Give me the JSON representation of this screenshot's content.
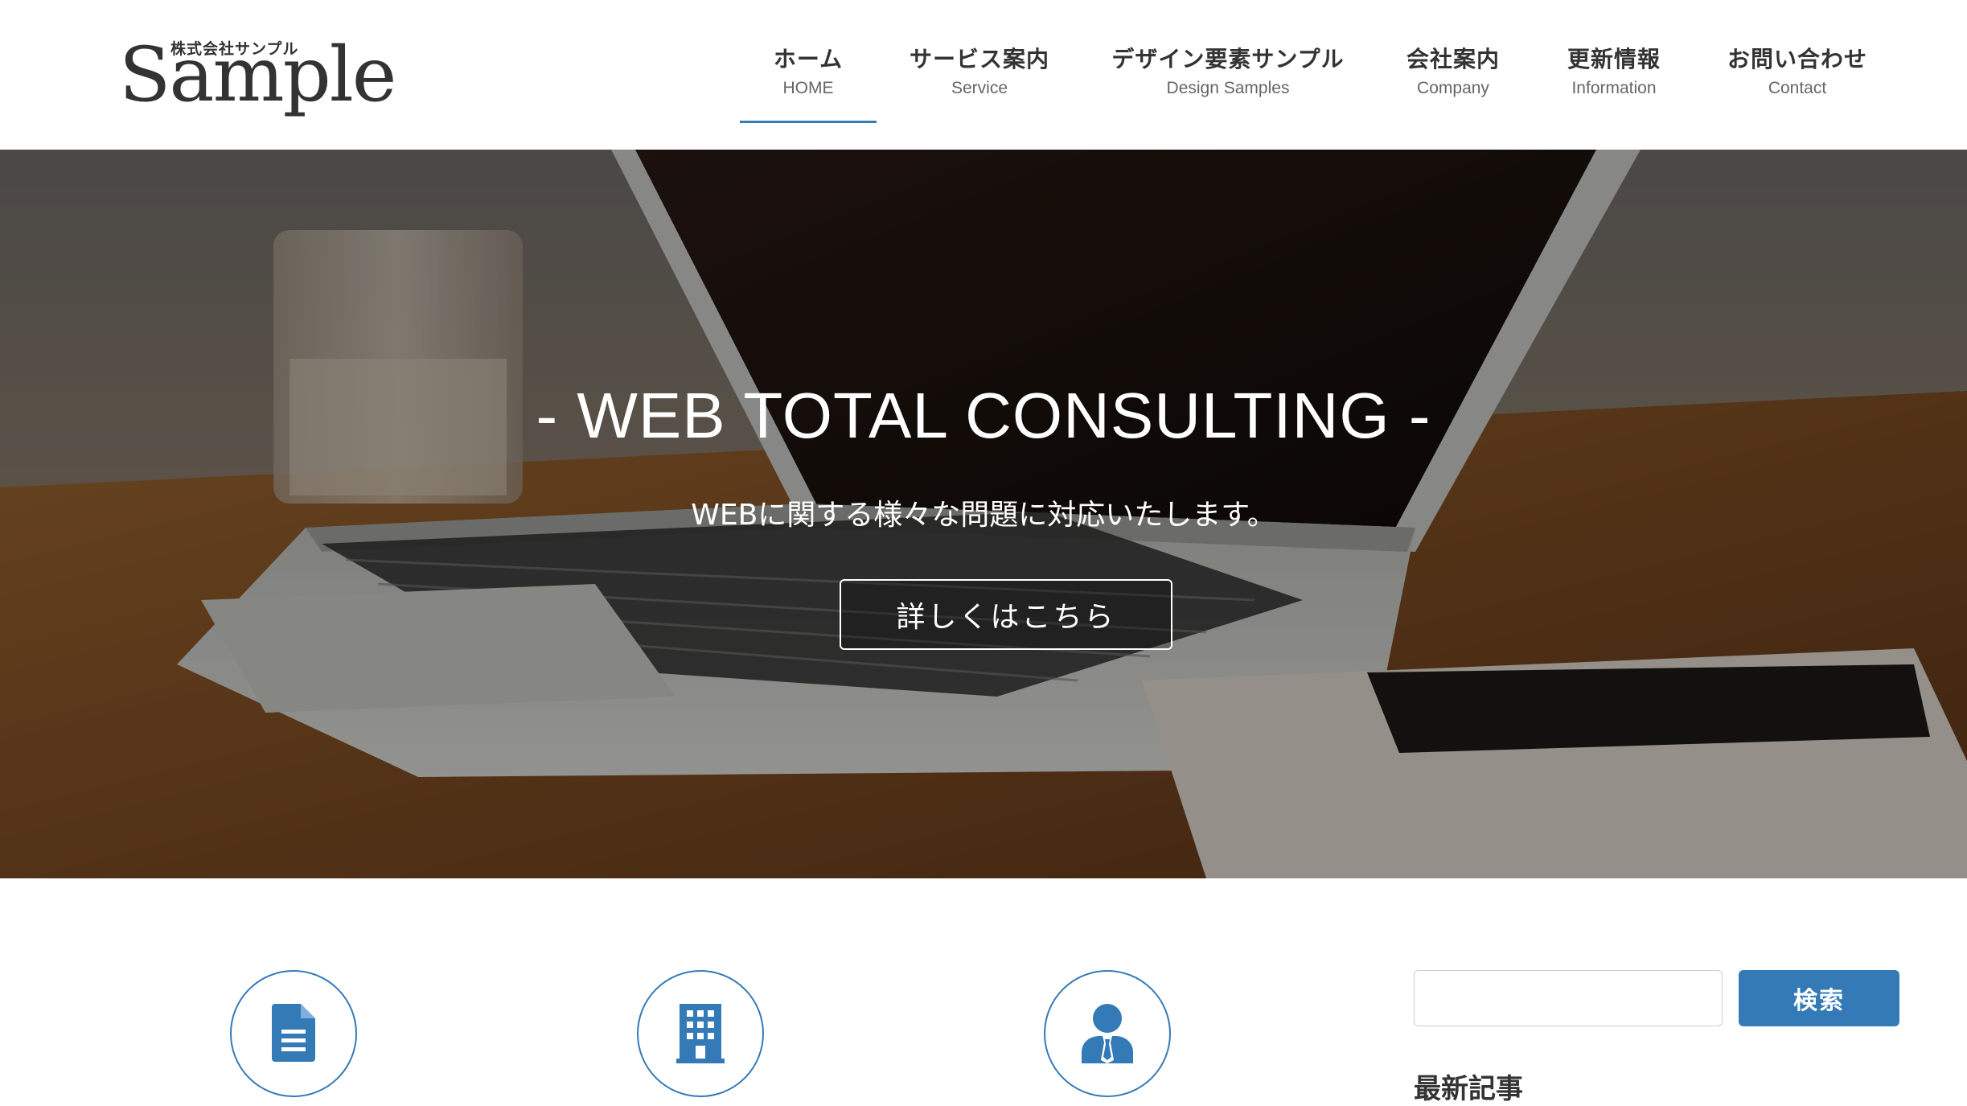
{
  "logo": {
    "sub": "株式会社サンプル",
    "main": "Sample"
  },
  "nav": [
    {
      "ja": "ホーム",
      "en": "HOME",
      "active": true
    },
    {
      "ja": "サービス案内",
      "en": "Service"
    },
    {
      "ja": "デザイン要素サンプル",
      "en": "Design Samples"
    },
    {
      "ja": "会社案内",
      "en": "Company"
    },
    {
      "ja": "更新情報",
      "en": "Information"
    },
    {
      "ja": "お問い合わせ",
      "en": "Contact"
    }
  ],
  "hero": {
    "title": "- WEB TOTAL CONSULTING -",
    "subtitle": "WEBに関する様々な問題に対応いたします。",
    "button": "詳しくはこちら"
  },
  "features": [
    {
      "icon": "document-icon"
    },
    {
      "icon": "building-icon"
    },
    {
      "icon": "businessman-icon"
    }
  ],
  "sidebar": {
    "search_placeholder": "",
    "search_button": "検索",
    "heading": "最新記事"
  },
  "colors": {
    "accent": "#337ab7",
    "text": "#333333",
    "subtext": "#666666"
  }
}
